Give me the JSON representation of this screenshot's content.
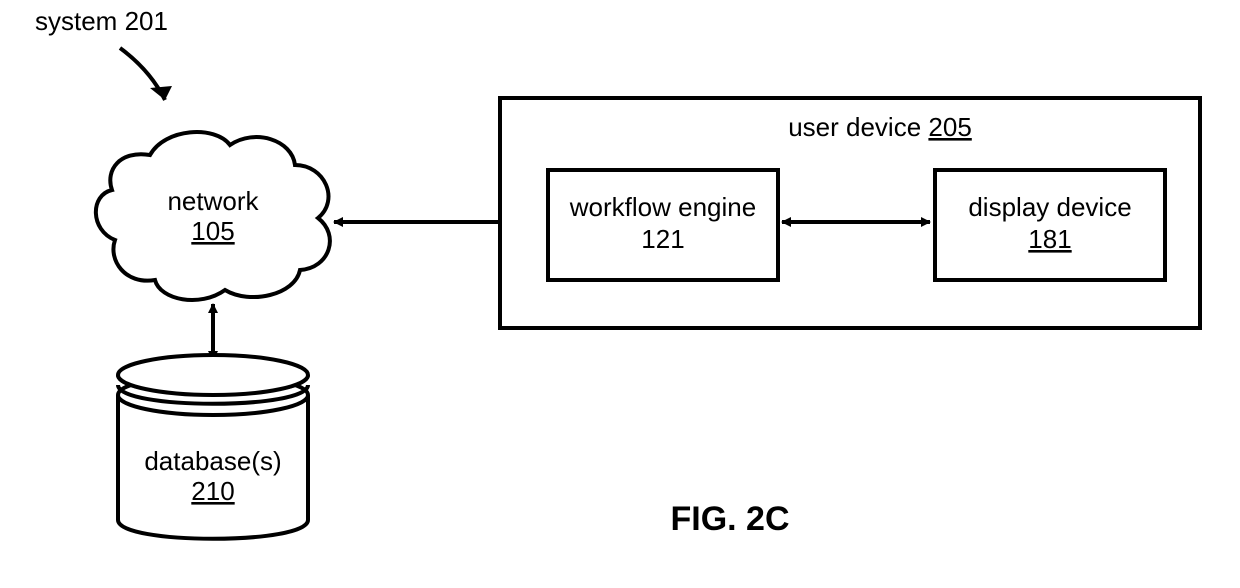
{
  "title_label": "system 201",
  "network": {
    "name": "network",
    "ref": "105"
  },
  "database": {
    "name": "database(s)",
    "ref": "210"
  },
  "user_device": {
    "name": "user device",
    "ref": "205"
  },
  "workflow_engine": {
    "name": "workflow engine",
    "ref": "121"
  },
  "display_device": {
    "name": "display device",
    "ref": "181"
  },
  "figure_caption": "FIG. 2C"
}
